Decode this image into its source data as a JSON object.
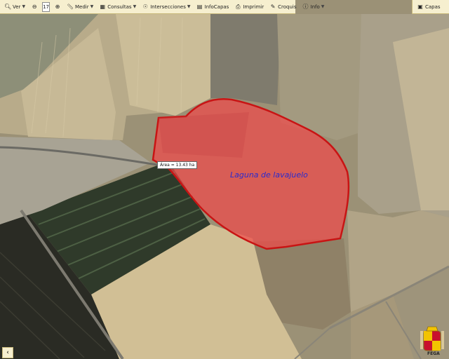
{
  "toolbar": {
    "ver": "Ver",
    "zoom_level": "17",
    "medir": "Medir",
    "consultas": "Consultas",
    "intersecciones": "Intersecciones",
    "infocapas": "InfoCapas",
    "imprimir": "Imprimir",
    "croquis": "Croquis",
    "info": "Info"
  },
  "right_panel": {
    "capas": "Capas"
  },
  "map": {
    "area_measure": "Área = 13.43 ha",
    "parcel_label": "Laguna de lavajuelo",
    "parcel_fill": "#f04a4a",
    "parcel_stroke": "#c81414"
  },
  "footer": {
    "logo_text": "FEGA"
  }
}
